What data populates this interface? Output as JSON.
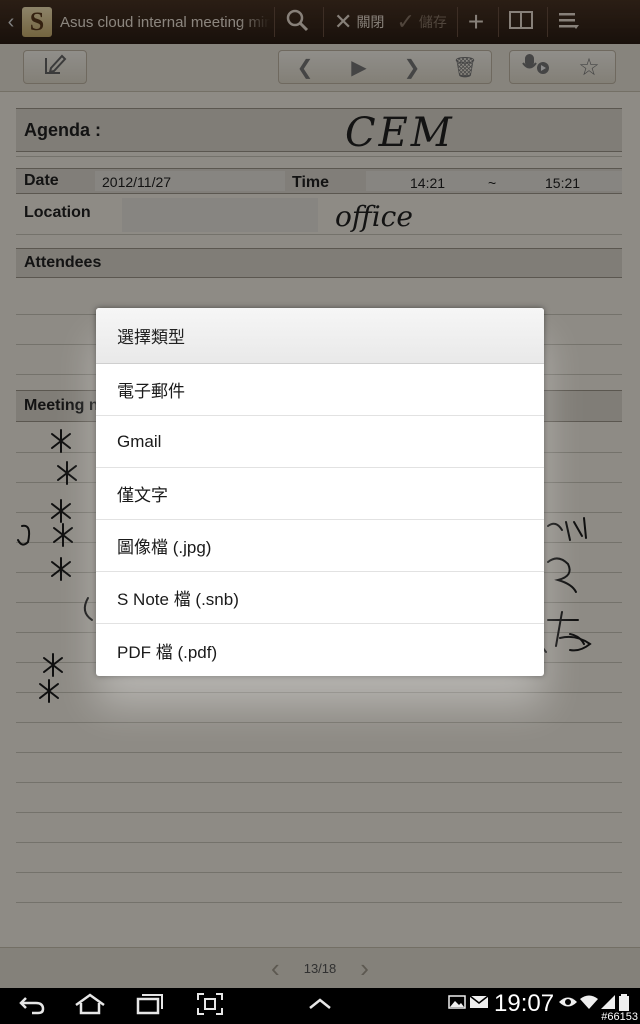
{
  "actionbar": {
    "title": "Asus cloud internal meeting minutes",
    "close_label": "關閉",
    "save_label": "儲存",
    "icons": [
      "back-icon",
      "snote-logo",
      "search-icon",
      "close-icon",
      "check-icon",
      "plus-icon",
      "layout-icon",
      "menu-icon"
    ]
  },
  "note": {
    "agenda_label": "Agenda :",
    "agenda_value": "CEM",
    "date_label": "Date",
    "date_value": "2012/11/27",
    "time_label": "Time",
    "time_start": "14:21",
    "time_sep": "~",
    "time_end": "15:21",
    "location_label": "Location",
    "location_value": "office",
    "attendees_label": "Attendees",
    "meeting_notes_label": "Meeting no"
  },
  "dialog": {
    "title": "選擇類型",
    "items": [
      "電子郵件",
      "Gmail",
      "僅文字",
      "圖像檔 (.jpg)",
      "S Note 檔 (.snb)",
      "PDF 檔 (.pdf)"
    ]
  },
  "pager": {
    "page": "13/18"
  },
  "statusbar": {
    "time": "19:07",
    "watermark": "#66153"
  }
}
